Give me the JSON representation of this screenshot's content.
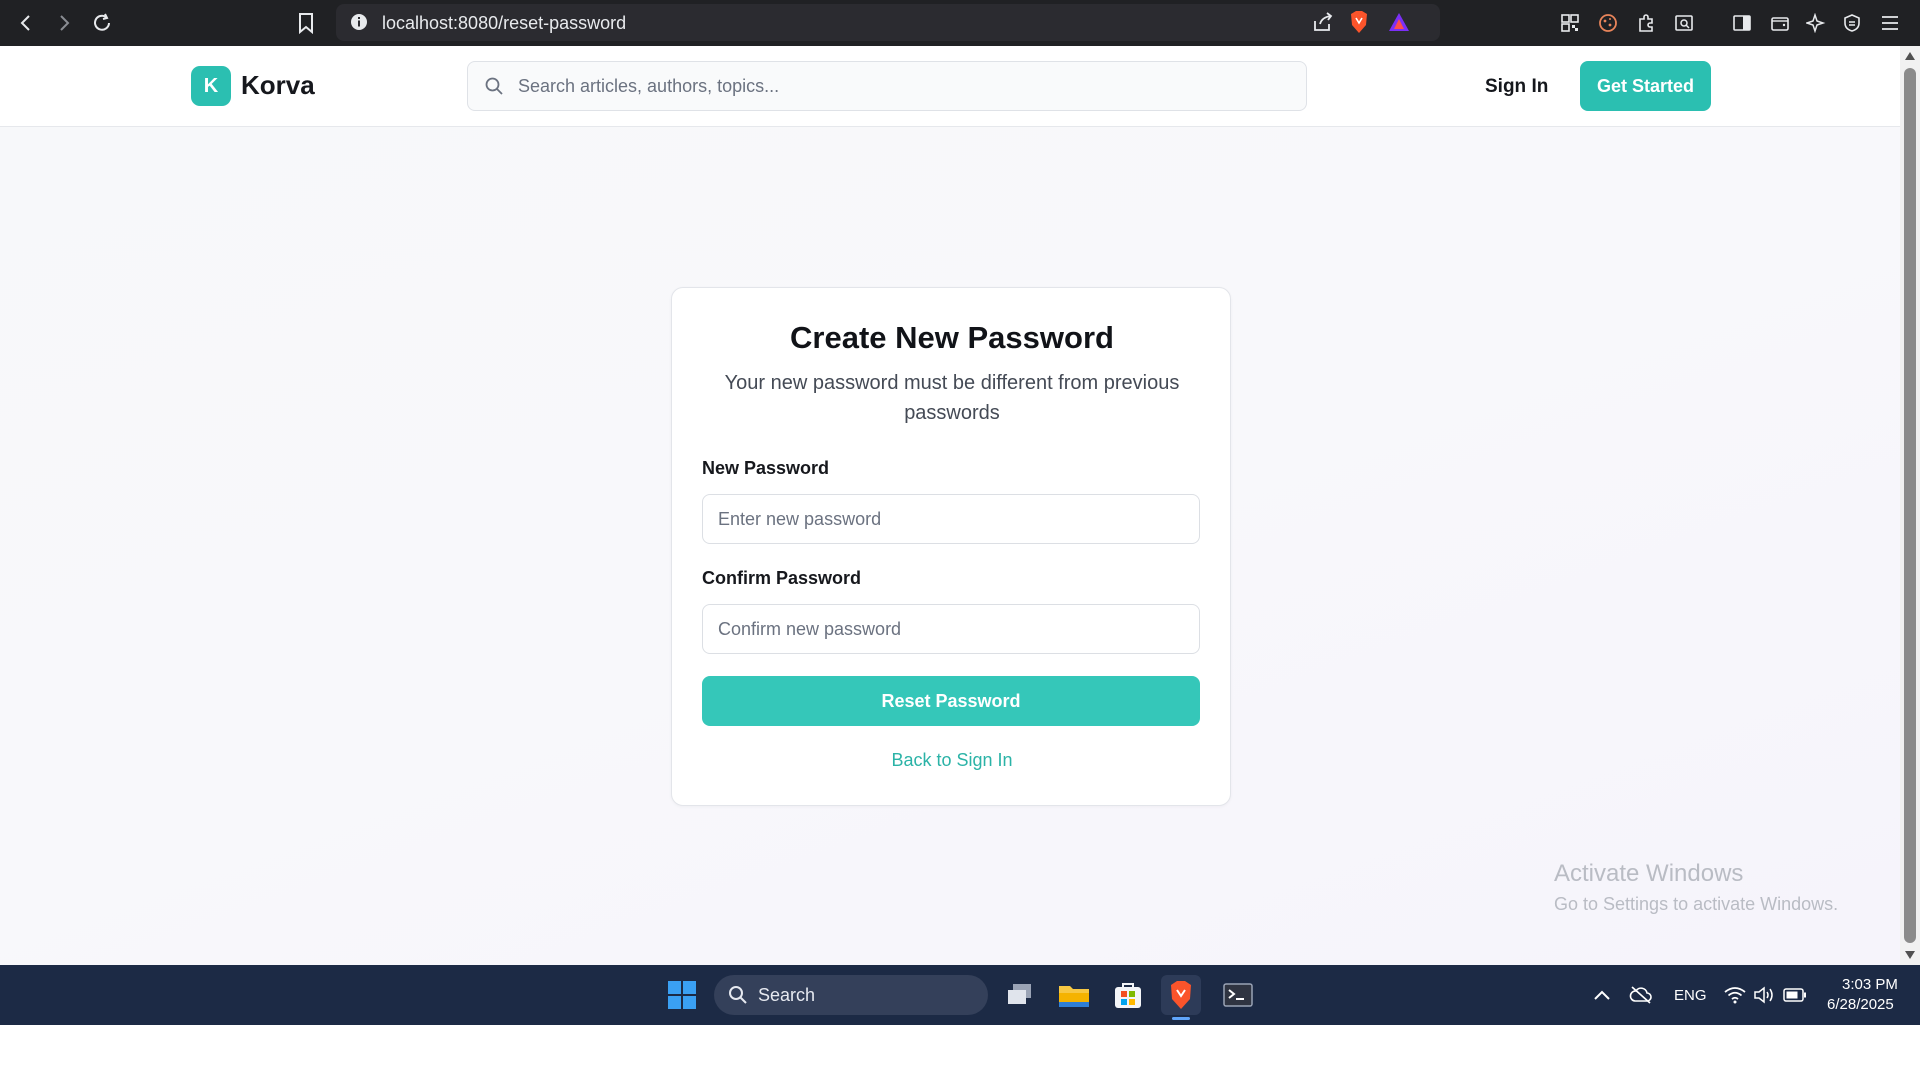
{
  "browser": {
    "url": "localhost:8080/reset-password"
  },
  "header": {
    "logo_letter": "K",
    "logo_text": "Korva",
    "search_placeholder": "Search articles, authors, topics...",
    "sign_in": "Sign In",
    "get_started": "Get Started"
  },
  "card": {
    "title": "Create New Password",
    "subtitle": "Your new password must be different from previous passwords",
    "new_password_label": "New Password",
    "new_password_placeholder": "Enter new password",
    "confirm_password_label": "Confirm Password",
    "confirm_password_placeholder": "Confirm new password",
    "submit_label": "Reset Password",
    "back_link": "Back to Sign In"
  },
  "watermark": {
    "title": "Activate Windows",
    "subtitle": "Go to Settings to activate Windows."
  },
  "taskbar": {
    "search_label": "Search",
    "language": "ENG",
    "time": "3:03 PM",
    "date": "6/28/2025"
  },
  "colors": {
    "accent": "#2bbfb1",
    "link": "#2bb3a7",
    "taskbar": "#1c2a45"
  }
}
